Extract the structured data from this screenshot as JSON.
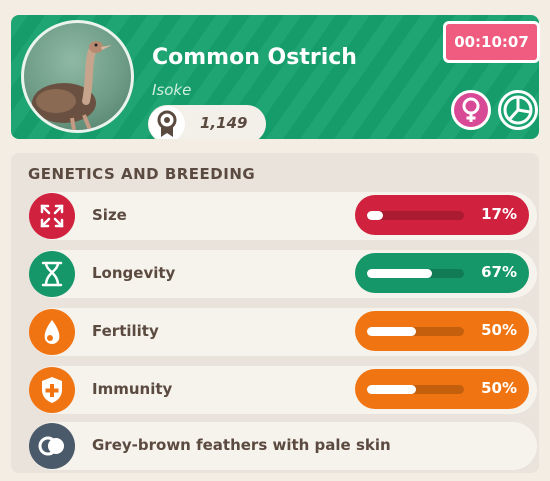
{
  "animal": {
    "name": "Common Ostrich",
    "nickname": "Isoke",
    "rating": "1,149",
    "timer": "00:10:07",
    "sex_icon": "female-icon",
    "colors": {
      "header": "#17a26f",
      "timer": "#ef5c7f",
      "female": "#d94a96"
    }
  },
  "genetics": {
    "title": "GENETICS AND BREEDING",
    "rows": [
      {
        "label": "Size",
        "percent_text": "17%",
        "fraction": 0.17,
        "color": "#d0213e",
        "icon": "expand-arrows-icon"
      },
      {
        "label": "Longevity",
        "percent_text": "67%",
        "fraction": 0.67,
        "color": "#15976a",
        "icon": "hourglass-icon"
      },
      {
        "label": "Fertility",
        "percent_text": "50%",
        "fraction": 0.5,
        "color": "#f07512",
        "icon": "egg-icon"
      },
      {
        "label": "Immunity",
        "percent_text": "50%",
        "fraction": 0.5,
        "color": "#f07512",
        "icon": "shield-plus-icon"
      }
    ],
    "trait": {
      "label": "Grey-brown feathers with pale skin",
      "icon": "color-pattern-icon"
    }
  }
}
